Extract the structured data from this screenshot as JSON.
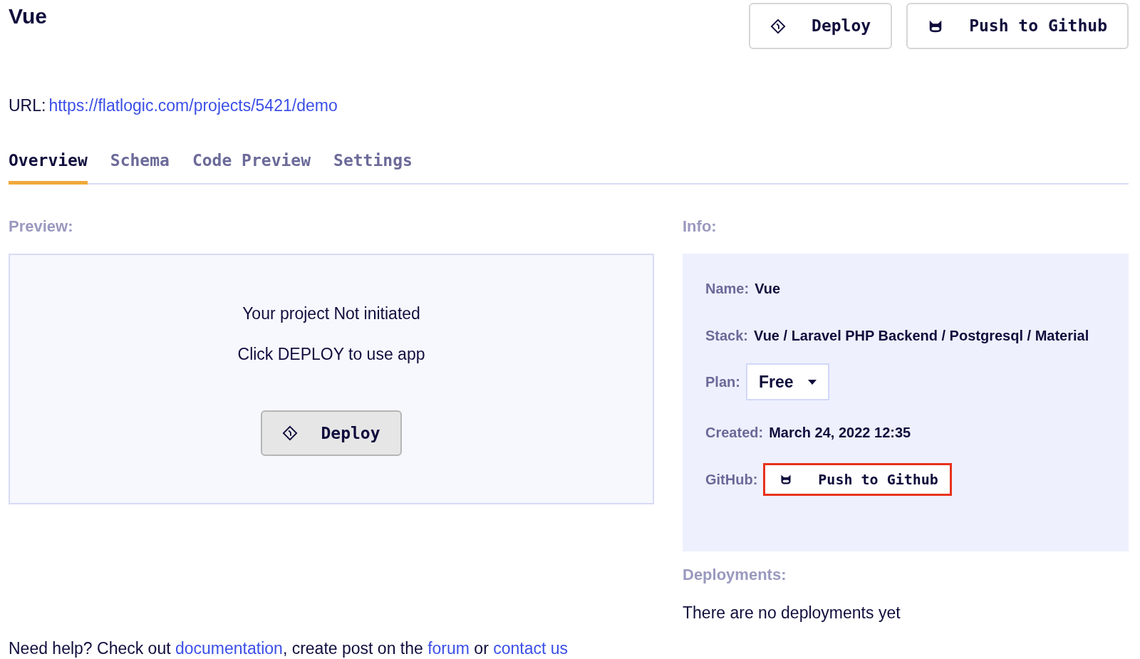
{
  "title": "Vue",
  "header_buttons": [
    {
      "kind": "deploy",
      "label": "Deploy"
    },
    {
      "kind": "github",
      "label": "Push to Github"
    }
  ],
  "url": {
    "label": "URL:",
    "link": "https://flatlogic.com/projects/5421/demo"
  },
  "tabs": [
    {
      "label": "Overview",
      "selected": true
    },
    {
      "label": "Schema",
      "selected": false
    },
    {
      "label": "Code Preview",
      "selected": false
    },
    {
      "label": "Settings",
      "selected": false
    }
  ],
  "preview": {
    "heading": "Preview:",
    "lines": [
      "Your project Not initiated",
      "Click DEPLOY to use app"
    ],
    "button": {
      "kind": "deploy",
      "label": "Deploy"
    }
  },
  "info": {
    "heading": "Info:",
    "name": {
      "label": "Name:",
      "value": "Vue"
    },
    "stack": {
      "label": "Stack:",
      "value": "Vue / Laravel PHP Backend / Postgresql / Material"
    },
    "plan": {
      "label": "Plan:",
      "value": "Free"
    },
    "created": {
      "label": "Created:",
      "value": "March 24, 2022 12:35"
    },
    "github": {
      "label": "GitHub:",
      "button": {
        "kind": "github",
        "label": "Push to Github",
        "highlighted": true
      }
    }
  },
  "deployments": {
    "heading": "Deployments:",
    "text": "There are no deployments yet"
  },
  "help": {
    "parts": [
      {
        "kind": "text",
        "text": "Need help? Check out "
      },
      {
        "kind": "link",
        "text": "documentation"
      },
      {
        "kind": "text",
        "text": ", create post on the "
      },
      {
        "kind": "link",
        "text": "forum"
      },
      {
        "kind": "text",
        "text": " or "
      },
      {
        "kind": "link",
        "text": "contact us"
      }
    ]
  }
}
